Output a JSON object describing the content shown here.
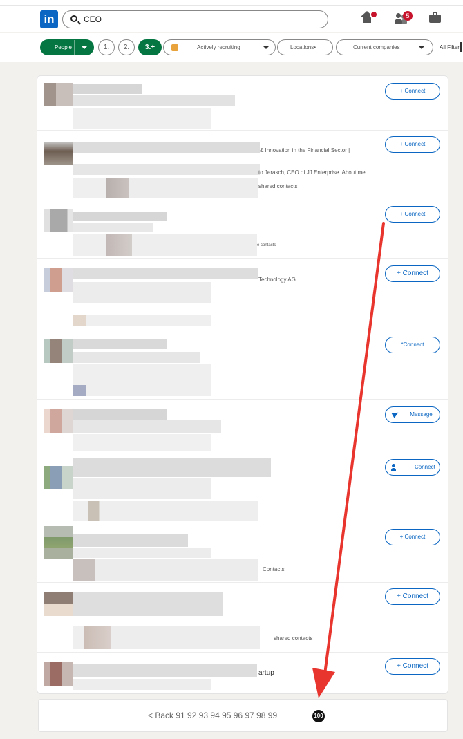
{
  "nav": {
    "logo": "in",
    "search_value": "CEO",
    "notifications_badge": "5"
  },
  "filters": {
    "people": "People",
    "degree_1": "1.",
    "degree_2": "2.",
    "degree_3": "3.+",
    "recruiting": "Actively recruiting",
    "locations": "Locations•",
    "current_companies": "Current companies",
    "all_filters": "All Filter"
  },
  "results": [
    {
      "button": "+ Connect",
      "snippets": []
    },
    {
      "button": "+ Connect",
      "snippets": [
        "& Innovation in the Financial Sector |",
        "to Jerasch, CEO of JJ Enterprise. About me...",
        "shared contacts"
      ]
    },
    {
      "button": "+ Connect",
      "snippets": [
        "e contacts"
      ]
    },
    {
      "button": "+ Connect",
      "snippets": [
        "Technology AG"
      ]
    },
    {
      "button": "*Connect",
      "snippets": []
    },
    {
      "button": "Message",
      "snippets": []
    },
    {
      "button": "Connect",
      "snippets": []
    },
    {
      "button": "+ Connect",
      "snippets": [
        "Contacts"
      ]
    },
    {
      "button": "+ Connect",
      "snippets": [
        "shared contacts"
      ]
    },
    {
      "button": "+ Connect",
      "snippets": [
        "artup"
      ]
    }
  ],
  "pagination": {
    "prev_and_pages": "< Back 91 92 93 94 95 96 97 98 99",
    "current": "100"
  },
  "colors": {
    "brand": "#0a66c2",
    "active_filter": "#057642",
    "badge": "#c7142c",
    "annotation_arrow": "#e8352e"
  }
}
